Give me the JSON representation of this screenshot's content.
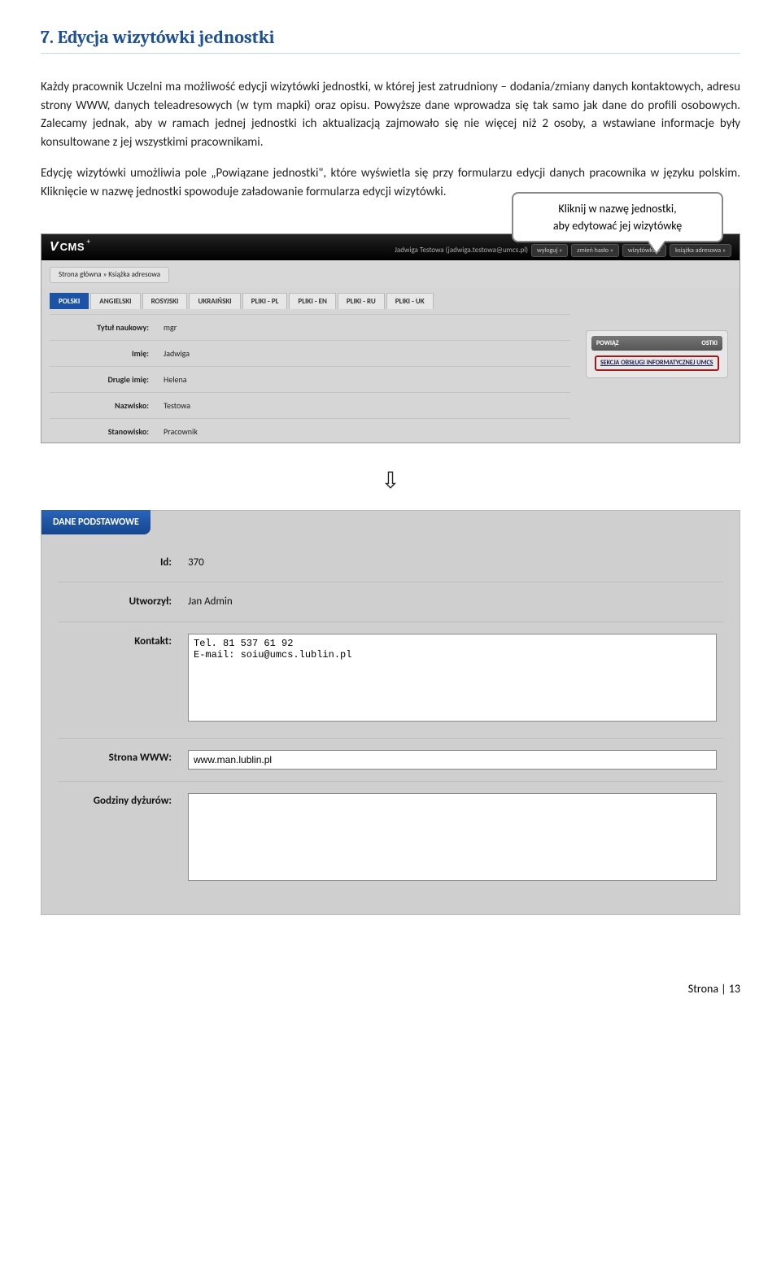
{
  "heading": "7. Edycja wizytówki jednostki",
  "para1": "Każdy pracownik Uczelni ma możliwość edycji wizytówki jednostki, w której jest zatrudniony – dodania/zmiany danych kontaktowych, adresu strony WWW, danych teleadresowych (w tym mapki) oraz opisu. Powyższe dane wprowadza się tak samo jak dane do profili osobowych. Zalecamy jednak, aby w ramach jednej jednostki ich aktualizacją zajmowało się nie więcej niż 2 osoby, a wstawiane informacje były konsultowane z jej wszystkimi pracownikami.",
  "para2": "Edycję wizytówki umożliwia pole „Powiązane jednostki\", które wyświetla się przy formularzu edycji danych pracownika w języku polskim. Kliknięcie w nazwę jednostki spowoduje załadowanie formularza edycji wizytówki.",
  "callout": "Kliknij w nazwę jednostki,\naby edytować jej wizytówkę",
  "topbar": {
    "user": "Jadwiga Testowa (jadwiga.testowa@umcs.pl)",
    "links": [
      "wyloguj »",
      "zmień hasło »",
      "wizytówka »",
      "książka adresowa »"
    ]
  },
  "breadcrumb": "Strona główna » Książka adresowa",
  "tabs": [
    "POLSKI",
    "ANGIELSKI",
    "ROSYJSKI",
    "UKRAIŃSKI",
    "PLIKI - PL",
    "PLIKI - EN",
    "PLIKI - RU",
    "PLIKI - UK"
  ],
  "form1": {
    "rows": [
      {
        "label": "Tytuł naukowy:",
        "value": "mgr"
      },
      {
        "label": "Imię:",
        "value": "Jadwiga"
      },
      {
        "label": "Drugie imię:",
        "value": "Helena"
      },
      {
        "label": "Nazwisko:",
        "value": "Testowa"
      },
      {
        "label": "Stanowisko:",
        "value": "Pracownik"
      }
    ]
  },
  "sidepanel": {
    "head_left": "POWIĄZ",
    "head_right": "OSTKI",
    "link": "SEKCJA OBSŁUGI INFORMATYCZNEJ UMCS"
  },
  "ribbon": "DANE PODSTAWOWE",
  "form2": {
    "id_label": "Id:",
    "id_value": "370",
    "created_label": "Utworzył:",
    "created_value": "Jan Admin",
    "contact_label": "Kontakt:",
    "contact_value": "Tel. 81 537 61 92\nE-mail: soiu@umcs.lublin.pl",
    "www_label": "Strona WWW:",
    "www_value": "www.man.lublin.pl",
    "hours_label": "Godziny dyżurów:",
    "hours_value": ""
  },
  "footer": "Strona | 13"
}
